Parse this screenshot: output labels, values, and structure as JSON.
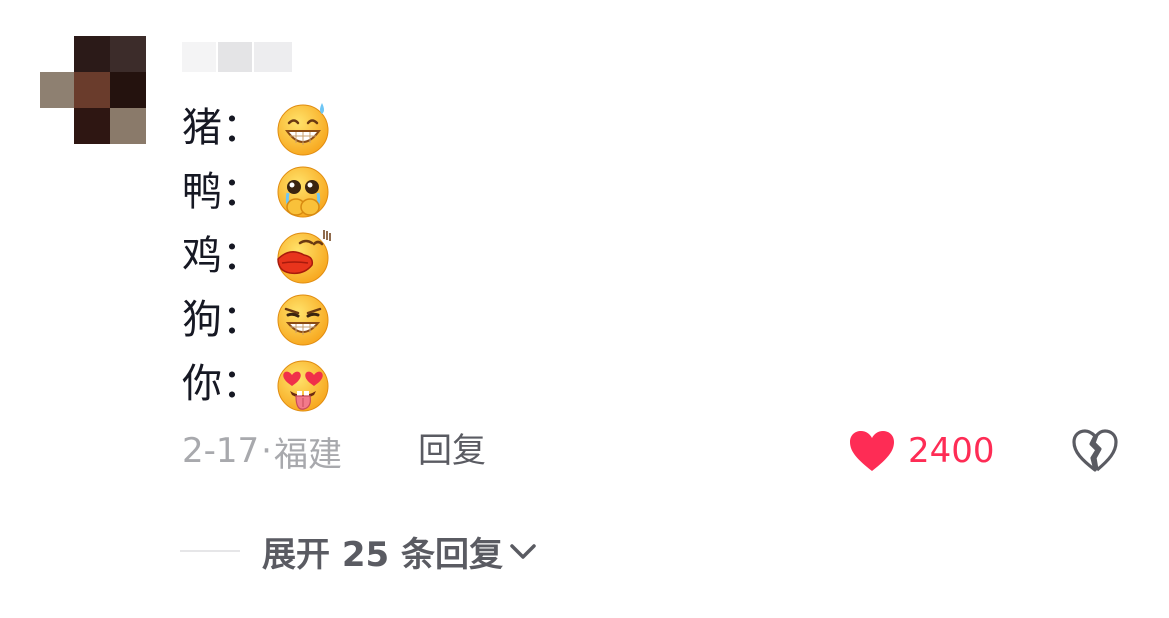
{
  "comment": {
    "lines": [
      {
        "text": "猪：",
        "emoji": "grinning-sweat-emoji"
      },
      {
        "text": "鸭：",
        "emoji": "crying-hands-over-mouth-emoji"
      },
      {
        "text": "鸡：",
        "emoji": "big-lips-emoji"
      },
      {
        "text": "狗：",
        "emoji": "smirking-grin-emoji"
      },
      {
        "text": "你：",
        "emoji": "heart-eyes-tongue-emoji"
      }
    ],
    "date": "2-17",
    "separator": "·",
    "location": "福建",
    "reply_label": "回复",
    "like_count": "2400",
    "expand_label": "展开 25 条回复"
  },
  "colors": {
    "like": "#fe2c55",
    "text": "#161823",
    "meta": "#a8a9ad",
    "action": "#5a5b62"
  },
  "icons": {
    "like": "heart-icon",
    "dislike": "broken-heart-icon",
    "expand": "chevron-down-icon"
  }
}
